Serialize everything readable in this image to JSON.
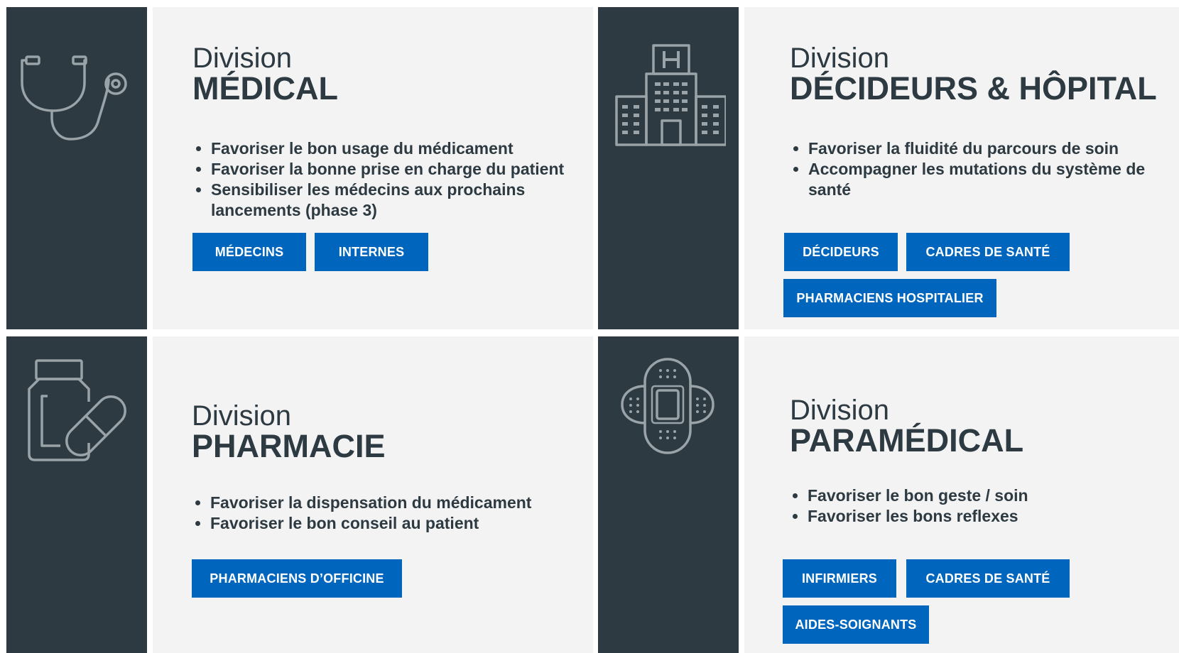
{
  "colors": {
    "dark_panel": "#2d3a42",
    "content_bg": "#f3f3f3",
    "button": "#0066bd",
    "icon_stroke": "#9aa3a8"
  },
  "cards": {
    "medical": {
      "icon": "stethoscope-icon",
      "title_small": "Division",
      "title_big": "MÉDICAL",
      "bullets": [
        "Favoriser le bon usage du médicament",
        "Favoriser la bonne prise en charge du patient",
        "Sensibiliser les médecins aux prochains lancements (phase 3)"
      ],
      "buttons": [
        "MÉDECINS",
        "INTERNES"
      ]
    },
    "decideurs": {
      "icon": "hospital-icon",
      "title_small": "Division",
      "title_big": "DÉCIDEURS & HÔPITAL",
      "bullets": [
        "Favoriser la fluidité du parcours de soin",
        "Accompagner les mutations du système de santé"
      ],
      "buttons": [
        "DÉCIDEURS",
        "CADRES DE SANTÉ",
        "PHARMACIENS HOSPITALIER"
      ]
    },
    "pharmacie": {
      "icon": "pill-bottle-icon",
      "title_small": "Division",
      "title_big": "PHARMACIE",
      "bullets": [
        "Favoriser la dispensation du médicament",
        "Favoriser le bon conseil au patient"
      ],
      "buttons": [
        "PHARMACIENS D’OFFICINE"
      ]
    },
    "paramedical": {
      "icon": "bandage-icon",
      "title_small": "Division",
      "title_big": "PARAMÉDICAL",
      "bullets": [
        "Favoriser le bon geste / soin",
        "Favoriser les bons reflexes"
      ],
      "buttons": [
        "INFIRMIERS",
        "CADRES DE SANTÉ",
        "AIDES-SOIGNANTS"
      ]
    }
  }
}
